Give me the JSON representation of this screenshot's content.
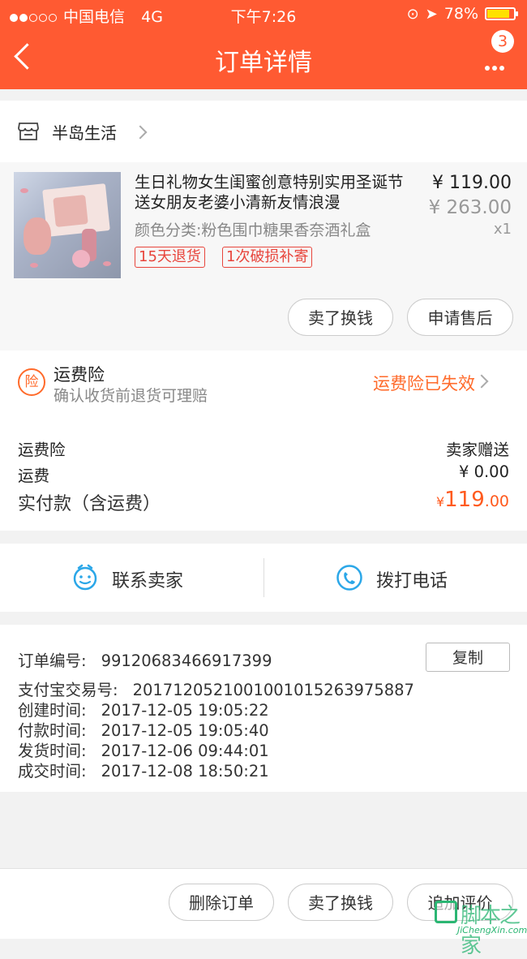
{
  "status": {
    "carrier": "中国电信",
    "network": "4G",
    "time": "下午7:26",
    "battery": "78%",
    "battery_level": 0.78
  },
  "nav": {
    "title": "订单详情",
    "badge": "3"
  },
  "store": {
    "name": "半岛生活"
  },
  "product": {
    "title": "生日礼物女生闺蜜创意特别实用圣诞节送女朋友老婆小清新友情浪漫",
    "price": "¥ 119.00",
    "original_price": "¥ 263.00",
    "quantity": "x1",
    "sku": "颜色分类:粉色围巾糖果香奈酒礼盒",
    "tags": [
      "15天退货",
      "1次破损补寄"
    ]
  },
  "item_actions": {
    "sell": "卖了换钱",
    "after_sale": "申请售后"
  },
  "insurance": {
    "icon_char": "险",
    "title": "运费险",
    "subtitle": "确认收货前退货可理赔",
    "status": "运费险已失效"
  },
  "fees": {
    "insurance_label": "运费险",
    "insurance_value": "卖家赠送",
    "shipping_label": "运费",
    "shipping_value": "¥ 0.00",
    "total_label": "实付款（含运费）",
    "total_currency": "¥",
    "total_int": "119",
    "total_dec": ".00"
  },
  "contact": {
    "seller": "联系卖家",
    "call": "拨打电话"
  },
  "order_info": {
    "order_no_label": "订单编号:",
    "order_no": "99120683466917399",
    "copy": "复制",
    "alipay_label": "支付宝交易号:",
    "alipay_no": "2017120521001001015263975887",
    "created_label": "创建时间:",
    "created": "2017-12-05 19:05:22",
    "paid_label": "付款时间:",
    "paid": "2017-12-05 19:05:40",
    "shipped_label": "发货时间:",
    "shipped": "2017-12-06 09:44:01",
    "done_label": "成交时间:",
    "done": "2017-12-08 18:50:21"
  },
  "bottom_actions": {
    "delete": "删除订单",
    "sell": "卖了换钱",
    "review": "追加评价"
  },
  "watermark": {
    "text": "脚本之家",
    "url": "JiChengXin.com"
  },
  "colors": {
    "brand": "#ff5a32",
    "accent": "#ff6a2a",
    "tag": "#e8453c",
    "contact": "#2ba7e8"
  }
}
